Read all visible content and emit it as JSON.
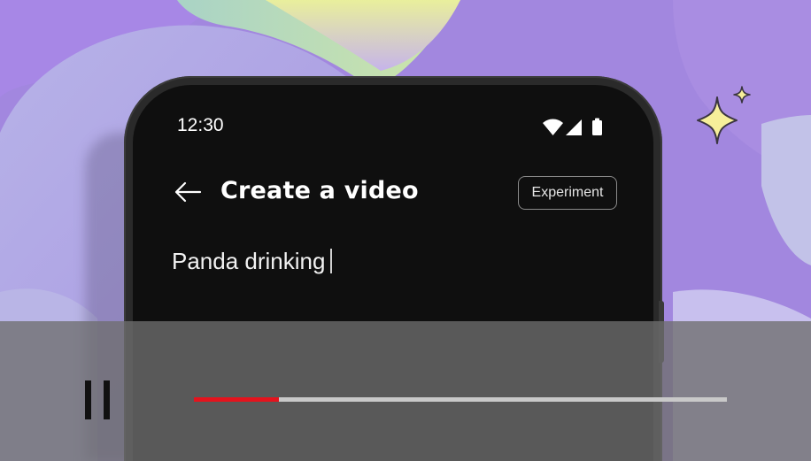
{
  "status_bar": {
    "time": "12:30",
    "icons": [
      "wifi-icon",
      "cellular-signal-icon",
      "battery-icon"
    ]
  },
  "header": {
    "back_icon": "arrow-left-icon",
    "title": "Create a video",
    "badge": "Experiment"
  },
  "prompt_input": {
    "value": "Panda drinking"
  },
  "player": {
    "control_icon": "pause-icon",
    "progress": 0.16,
    "colors": {
      "progress_fill": "#e5131d",
      "progress_track": "#c9c9c9"
    }
  },
  "decoration": {
    "sparkle_icon": "sparkle-icon",
    "colors": {
      "background": "#9f86dd",
      "sparkle": "#f6ef9a"
    }
  }
}
